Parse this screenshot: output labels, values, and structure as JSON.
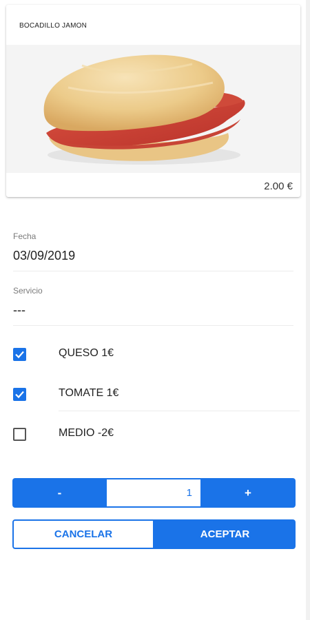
{
  "product": {
    "title": "BOCADILLO JAMON",
    "image_icon": "sandwich-photo",
    "price": "2.00 €"
  },
  "form": {
    "date_label": "Fecha",
    "date_value": "03/09/2019",
    "service_label": "Servicio",
    "service_value": "---"
  },
  "options": [
    {
      "label": "QUESO 1€",
      "checked": true
    },
    {
      "label": "TOMATE 1€",
      "checked": true
    },
    {
      "label": "MEDIO -2€",
      "checked": false
    }
  ],
  "quantity": {
    "minus_label": "-",
    "value": "1",
    "plus_label": "+"
  },
  "actions": {
    "cancel_label": "CANCELAR",
    "accept_label": "ACEPTAR"
  },
  "colors": {
    "accent": "#1a73e8",
    "checkbox_border": "#555555",
    "divider": "#ececec"
  }
}
